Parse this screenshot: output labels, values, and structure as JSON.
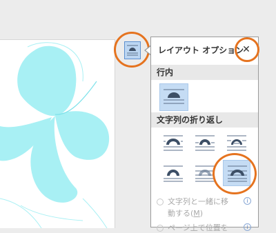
{
  "panel": {
    "title": "レイアウト オプション",
    "close_glyph": "✕",
    "section_inline": "行内",
    "section_wrap": "文字列の折り返し",
    "options": [
      {
        "line1": "文字列と一緒に移",
        "line2": "動する(",
        "mnemonic": "M",
        "line2_end": ")"
      },
      {
        "line1": "ページ上で位置を"
      }
    ],
    "info_glyph": "i"
  },
  "colors": {
    "accent_circle": "#e5731f",
    "selected_bg": "#c5dcf4",
    "flower_fill": "#a8f0f4",
    "flower_outline": "#7fe2ea"
  },
  "icons": {
    "anchor_button": "layout-options-icon",
    "wrap_inline": "wrap-inline-icon",
    "wrap_types": [
      "wrap-square-icon",
      "wrap-tight-icon",
      "wrap-through-icon",
      "wrap-top-bottom-icon",
      "wrap-behind-text-icon",
      "wrap-in-front-of-text-icon"
    ]
  }
}
